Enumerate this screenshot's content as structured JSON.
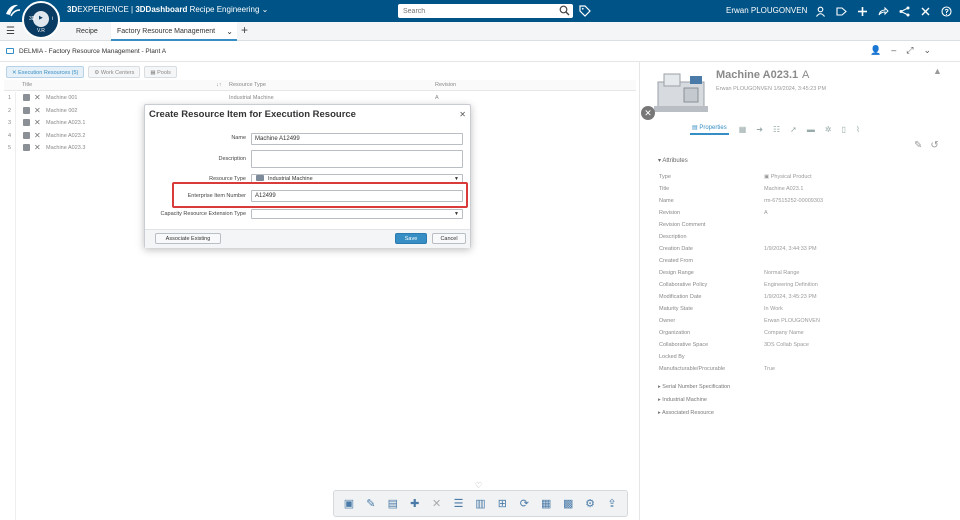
{
  "topbar": {
    "brand_strong": "3D",
    "brand_rest": "EXPERIENCE | ",
    "app_name": "3DDashboard",
    "dashboard_name": "Recipe Engineering",
    "compass_version": "V.R",
    "compass_labels": [
      "3D",
      "▶",
      "i"
    ],
    "search_placeholder": "Search",
    "user_name": "Erwan PLOUGONVEN",
    "icons": [
      "user-icon",
      "tag-icon",
      "plus-icon",
      "share-icon",
      "connect-icon",
      "tools-icon",
      "help-icon"
    ]
  },
  "tabs": {
    "items": [
      {
        "label": "Recipe"
      },
      {
        "label": "Factory Resource Management"
      }
    ]
  },
  "breadcrumb": {
    "title": "DELMIA - Factory Resource Management - Plant A"
  },
  "left": {
    "subtabs": [
      {
        "label": "Execution Resources (5)"
      },
      {
        "label": "Work Centers"
      },
      {
        "label": "Pools"
      }
    ],
    "columns": {
      "title": "Title",
      "resource_type": "Resource Type",
      "revision": "Revision"
    },
    "sort_indicator": "↓↑",
    "rows": [
      {
        "num": "1",
        "title": "Machine 001",
        "type": "Industrial Machine",
        "revision": "A"
      },
      {
        "num": "2",
        "title": "Machine 002",
        "type": "",
        "revision": ""
      },
      {
        "num": "3",
        "title": "Machine A023.1",
        "type": "",
        "revision": ""
      },
      {
        "num": "4",
        "title": "Machine A023.2",
        "type": "",
        "revision": ""
      },
      {
        "num": "5",
        "title": "Machine A023.3",
        "type": "",
        "revision": ""
      }
    ]
  },
  "modal": {
    "title": "Create Resource Item for Execution Resource",
    "name_label": "Name",
    "name_value": "Machine A12499",
    "description_label": "Description",
    "description_value": "",
    "resource_type_label": "Resource Type",
    "resource_type_value": "Industrial Machine",
    "enterprise_label": "Enterprise Item Number",
    "enterprise_value": "A12499",
    "capacity_label": "Capacity Resource Extension Type",
    "capacity_value": "",
    "associate_label": "Associate Existing",
    "save_label": "Save",
    "cancel_label": "Cancel"
  },
  "right": {
    "title": "Machine A023.1",
    "revision": "A",
    "subtitle": "Erwan PLOUGONVEN 1/9/2024, 3:45:23 PM",
    "properties_tab": "Properties",
    "attributes_header": "Attributes",
    "attributes": [
      {
        "key": "Type",
        "value": "Physical Product"
      },
      {
        "key": "Title",
        "value": "Machine A023.1"
      },
      {
        "key": "Name",
        "value": "rm-67515252-00009303"
      },
      {
        "key": "Revision",
        "value": "A"
      },
      {
        "key": "Revision Comment",
        "value": ""
      },
      {
        "key": "Description",
        "value": ""
      },
      {
        "key": "Creation Date",
        "value": "1/9/2024, 3:44:33 PM"
      },
      {
        "key": "Created From",
        "value": ""
      },
      {
        "key": "Design Range",
        "value": "Normal Range"
      },
      {
        "key": "Collaborative Policy",
        "value": "Engineering Definition"
      },
      {
        "key": "Modification Date",
        "value": "1/9/2024, 3:45:23 PM"
      },
      {
        "key": "Maturity State",
        "value": "In Work"
      },
      {
        "key": "Owner",
        "value": "Erwan PLOUGONVEN"
      },
      {
        "key": "Organization",
        "value": "Company Name"
      },
      {
        "key": "Collaborative Space",
        "value": "3DS Collab Space"
      },
      {
        "key": "Locked By",
        "value": ""
      },
      {
        "key": "Manufacturable/Procurable",
        "value": "True"
      }
    ],
    "sections": [
      {
        "label": "Serial Number Specification"
      },
      {
        "label": "Industrial Machine"
      },
      {
        "label": "Associated Resource"
      }
    ]
  },
  "colors": {
    "topbar": "#005386",
    "accent": "#368ec4",
    "highlight": "#d93a3a"
  }
}
